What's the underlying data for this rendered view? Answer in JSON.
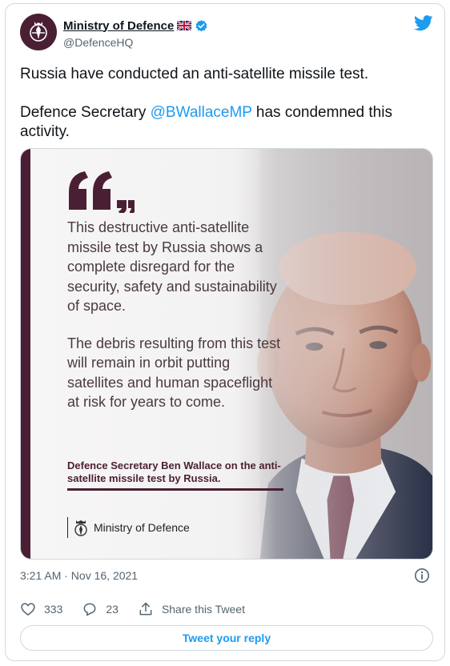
{
  "account": {
    "display_name": "Ministry of Defence",
    "handle": "@DefenceHQ",
    "flag_icon": "union-jack-flag-icon",
    "verified_icon": "verified-badge-icon"
  },
  "tweet": {
    "line1": "Russia have conducted an anti-satellite missile test.",
    "line2_prefix": "Defence Secretary ",
    "mention": "@BWallaceMP",
    "line2_suffix": " has condemned this activity."
  },
  "media": {
    "quote_paragraph_1": "This destructive anti-satellite missile test by Russia shows a complete disregard for the security, safety and sustainability of space.",
    "quote_paragraph_2": "The debris resulting from this test will remain in orbit putting satellites and human spaceflight at risk for years to come.",
    "attribution": "Defence Secretary Ben Wallace on the anti-satellite missile test by Russia.",
    "logo_text": "Ministry of Defence"
  },
  "meta": {
    "timestamp": "3:21 AM · Nov 16, 2021"
  },
  "actions": {
    "likes": "333",
    "replies": "23",
    "share_label": "Share this Tweet"
  },
  "reply_button": "Tweet your reply",
  "colors": {
    "accent": "#1d9bf0",
    "mod_maroon": "#4a1f33",
    "secondary_text": "#536471",
    "border": "#cfd9de"
  }
}
